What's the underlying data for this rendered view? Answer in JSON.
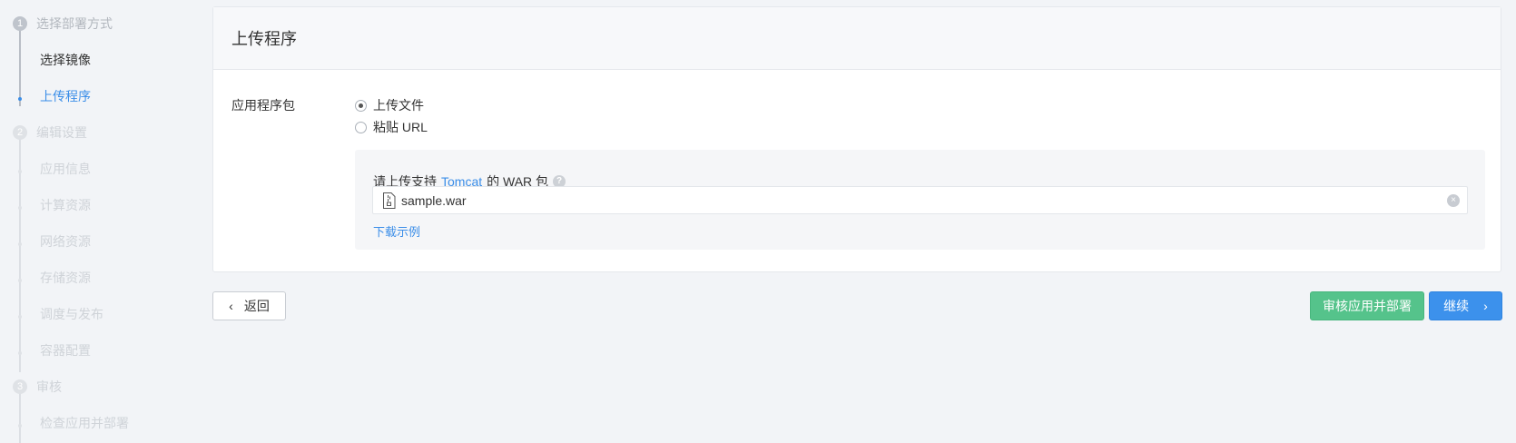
{
  "stepper": {
    "steps": [
      {
        "num": "1",
        "title": "选择部署方式"
      },
      {
        "num": "2",
        "title": "编辑设置"
      },
      {
        "num": "3",
        "title": "审核"
      }
    ],
    "substeps": [
      {
        "label": "选择镜像"
      },
      {
        "label": "上传程序"
      },
      {
        "label": "应用信息"
      },
      {
        "label": "计算资源"
      },
      {
        "label": "网络资源"
      },
      {
        "label": "存储资源"
      },
      {
        "label": "调度与发布"
      },
      {
        "label": "容器配置"
      },
      {
        "label": "检查应用并部署"
      }
    ]
  },
  "panel": {
    "title": "上传程序",
    "field_label": "应用程序包",
    "options": [
      {
        "label": "上传文件",
        "checked": true
      },
      {
        "label": "粘贴 URL",
        "checked": false
      }
    ],
    "hint_prefix": "请上传支持",
    "hint_link": "Tomcat",
    "hint_suffix": "的 WAR 包",
    "help_glyph": "?",
    "file_name": "sample.war",
    "clear_glyph": "×",
    "download_link": "下载示例"
  },
  "footer": {
    "back_label": "返回",
    "review_label": "审核应用并部署",
    "next_label": "继续"
  },
  "icons": {
    "help": "question-circle-icon",
    "file": "file-archive-icon",
    "clear": "close-circle-icon",
    "back": "chevron-left-icon",
    "next": "chevron-right-icon"
  },
  "colors": {
    "accent": "#3b8ee8",
    "success": "#55c38b",
    "background": "#f2f4f7"
  }
}
